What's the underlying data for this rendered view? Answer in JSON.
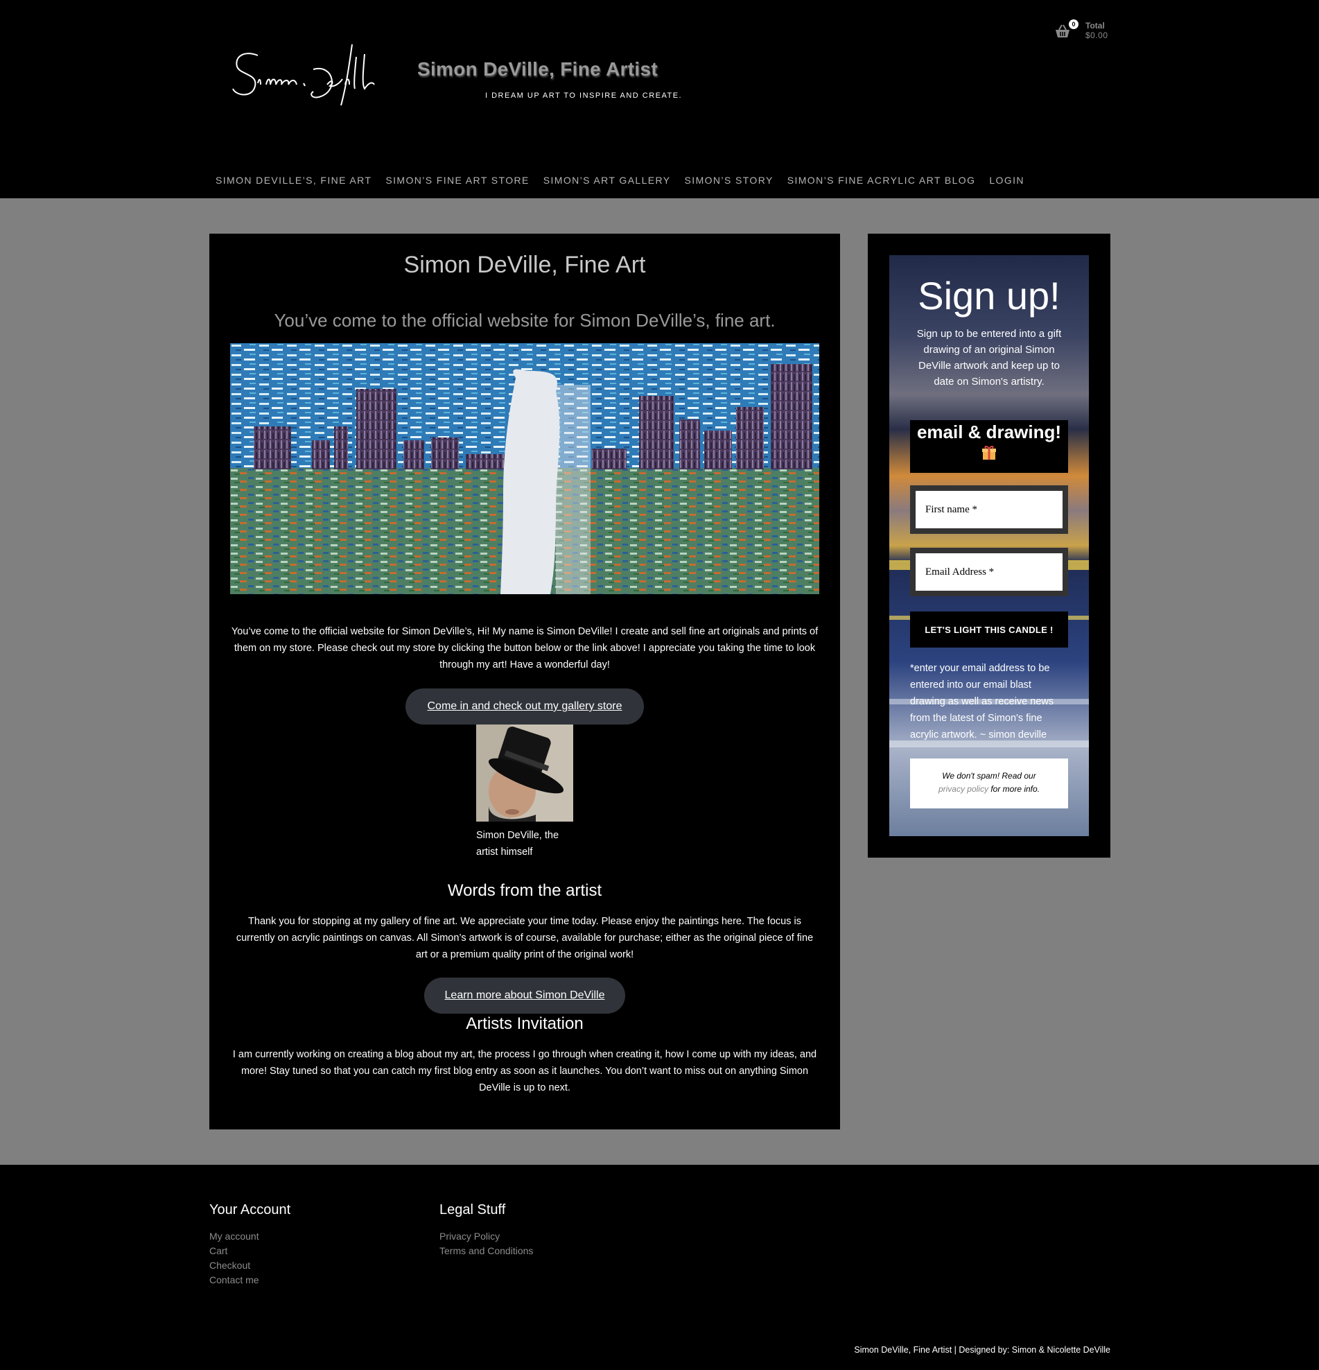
{
  "header": {
    "site_title": "Simon DeVille, Fine Artist",
    "tagline": "I DREAM UP ART TO INSPIRE AND CREATE.",
    "logo_signature": "Simon DeVille",
    "cart": {
      "count": "0",
      "total_label": "Total",
      "total_value": "$0.00"
    }
  },
  "nav": {
    "items": [
      {
        "label": "Simon DeVille’s, Fine Art"
      },
      {
        "label": "Simon’s Fine Art Store"
      },
      {
        "label": "Simon’s Art Gallery"
      },
      {
        "label": "Simon’s Story"
      },
      {
        "label": "Simon’s Fine Acrylic Art Blog"
      },
      {
        "label": "Login"
      }
    ]
  },
  "main": {
    "title": "Simon DeVille, Fine Art",
    "subtitle": "You’ve come to the official website for Simon DeVille’s, fine art.",
    "intro": "You’ve come to the official website for Simon DeVille’s, Hi! My name is Simon DeVille! I create and sell fine art originals and prints of them on my store. Please check out my store by clicking the button below or the link above! I appreciate you taking the time to look through my art! Have a wonderful day!",
    "store_button": "Come in and check out my gallery store",
    "portrait_caption": "Simon DeVille, the artist himself",
    "words_heading": "Words from the artist",
    "words_text": "Thank you for stopping at my gallery of fine art. We appreciate your time today. Please enjoy the paintings here. The focus is currently on acrylic paintings on canvas. All Simon’s artwork is of course, available for purchase; either as the original piece of fine art or a premium quality print of the original work!",
    "learn_button": "Learn more about Simon DeVille",
    "invite_heading": "Artists Invitation",
    "invite_text": "I am currently working on creating a blog about my art, the process I go through when creating it, how I come up with my ideas, and more! Stay tuned so that you can catch my first blog entry as soon as it launches. You don’t want to miss out on anything Simon DeVille is up to next."
  },
  "signup": {
    "title": "Sign up!",
    "description": "Sign up to be entered into a gift drawing of an original Simon DeVille artwork and keep up to date on Simon's artistry.",
    "drawing_title": "email & drawing!",
    "first_name_placeholder": "First name *",
    "email_placeholder": "Email Address *",
    "submit_label": "LET'S LIGHT THIS CANDLE !",
    "note": "*enter your email address to be entered into our email blast drawing as well as receive news from the latest of Simon's fine acrylic artwork. ~ simon deville",
    "nospam_prefix": "We don't spam! Read our",
    "privacy_link": "privacy policy",
    "nospam_suffix": "for more info."
  },
  "footer": {
    "account_heading": "Your Account",
    "account_links": [
      {
        "label": "My account"
      },
      {
        "label": "Cart"
      },
      {
        "label": "Checkout"
      },
      {
        "label": "Contact me"
      }
    ],
    "legal_heading": "Legal Stuff",
    "legal_links": [
      {
        "label": "Privacy Policy"
      },
      {
        "label": "Terms and Conditions"
      }
    ],
    "credit": "Simon DeVille, Fine Artist | Designed by: Simon & Nicolette DeVille"
  }
}
